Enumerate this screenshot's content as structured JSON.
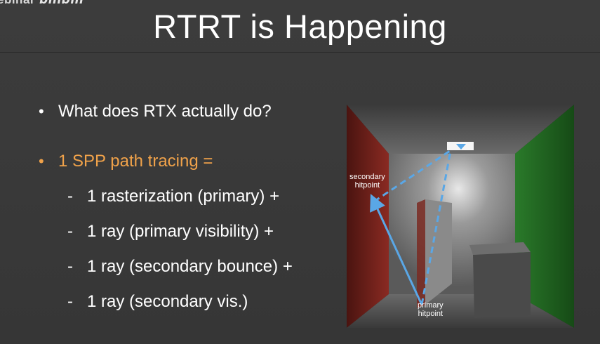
{
  "watermark": {
    "text": "ebinar",
    "logo": "bilibili"
  },
  "slide": {
    "title": "RTRT is Happening",
    "bullets": [
      {
        "text": "What does RTX actually do?",
        "accent": false
      },
      {
        "text": "1 SPP path tracing =",
        "accent": true
      }
    ],
    "subitems": [
      "1 rasterization (primary) +",
      "1 ray (primary visibility) +",
      "1 ray (secondary bounce) +",
      "1 ray (secondary vis.)"
    ],
    "bullet_glyph": "•",
    "dash_glyph": "-"
  },
  "figure": {
    "label_secondary": [
      "secondary",
      "hitpoint"
    ],
    "label_primary": [
      "primary",
      "hitpoint"
    ],
    "ray_color": "#5aa7e6",
    "accent_color": "#f0a24a"
  }
}
